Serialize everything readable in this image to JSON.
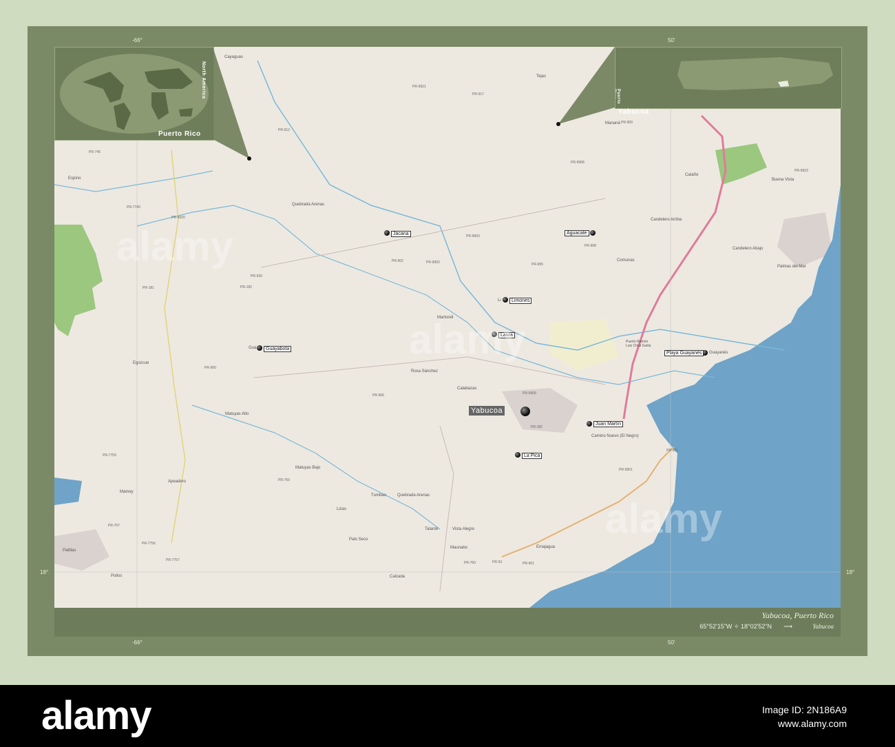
{
  "map": {
    "title": "Yabucoa, Puerto Rico",
    "coordinates": "65°52'15\"W ✧ 18°02'52\"N",
    "subtitle": "Yabucoa",
    "arrow": "⟶"
  },
  "graticule": {
    "top_left": "-66°",
    "bottom_left": "-66°",
    "left_lat": "18°",
    "right_lat": "18°",
    "top_50": "50'",
    "bottom_50": "50'"
  },
  "insets": {
    "world_label": "Puerto Rico",
    "continent_label": "North America",
    "island_label": "Yabucoa",
    "island_side": "Puerto Rico"
  },
  "markers": [
    {
      "name": "Jácana"
    },
    {
      "name": "Aguacate"
    },
    {
      "name": "Limones"
    },
    {
      "name": "Laura"
    },
    {
      "name": "Guayabota"
    },
    {
      "name": "Playa Guayanés"
    },
    {
      "name": "Juan Martín"
    },
    {
      "name": "La Pica"
    }
  ],
  "main_place": "Yabucoa",
  "places": {
    "cayaguas": "Cayaguas",
    "espino": "Espino",
    "quebrada_arenas": "Quebrada Arenas",
    "egozcue": "Egozcue",
    "matuyas_alto": "Matuyas Alto",
    "matuyas_bajo": "Matuyas Bajo",
    "mamey": "Mamey",
    "apeadero": "Apeadero",
    "patillas": "Patillas",
    "pollos": "Pollos",
    "calabazas": "Calabazas",
    "tumbao": "Tumbao",
    "talante": "Talante",
    "maunabo": "Maunabo",
    "emajagua": "Emajagua",
    "catano": "Cataño",
    "candelero_arriba": "Candelero Arriba",
    "candelero_abajo": "Candelero Abajo",
    "palmas_del_mar": "Palmas del Mar",
    "buena_vista": "Buena Vista",
    "manana": "Mananá",
    "tejas": "Tejas",
    "martorell": "Martorell",
    "rosa_sanchez": "Rosa Sánchez",
    "camino_nuevo": "Camino Nuevo (El Negro)",
    "calzada": "Calzada",
    "palo_seco": "Palo Seco",
    "lizas": "Lizas",
    "vista_alegre": "Vista Alegre",
    "comunas": "Comunas",
    "quebrada_arenas_s": "Quebrada Arenas",
    "guayanes_suffix": "Guayanés",
    "limones_prefix": "Li",
    "guayabota_prefix": "Gua",
    "puerto_yabucoa": "Puerto Ramón Luis Chiat Guilia"
  },
  "roads": [
    "PR-912",
    "PR-9921",
    "PR-917",
    "PR-9921",
    "PR-9908",
    "PR-909",
    "PR-9908",
    "PR-902",
    "PR-920",
    "PR-182",
    "PR-900",
    "PR-906",
    "PR-182",
    "PR-9909",
    "PR-901",
    "PR-9901",
    "PR-3",
    "PR-53",
    "PR-760",
    "PR-901",
    "PR-759",
    "PR-757",
    "PR-7756",
    "PR-7757",
    "PR-7759",
    "PR-181",
    "PR-7740",
    "PR-745",
    "PR-9920",
    "PR-9902",
    "PR-9903",
    "PR-905",
    "PR-908",
    "PR-9923"
  ],
  "watermark": "alamy",
  "footer": {
    "logo": "alamy",
    "image_id_label": "Image ID: 2N186A9",
    "site": "www.alamy.com"
  },
  "colors": {
    "frame": "#7b8a66",
    "sea": "#6fa3c8",
    "forest": "#9cc77e",
    "road_major": "#e07b9a",
    "road_secondary": "#e8b070",
    "river": "#7ab8d8"
  }
}
